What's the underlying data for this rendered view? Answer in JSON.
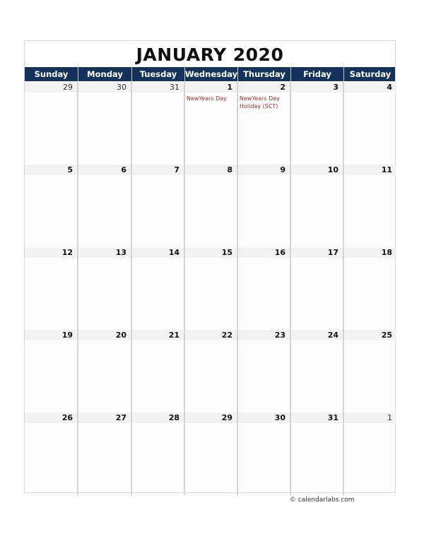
{
  "title": "JANUARY 2020",
  "weekdays": [
    "Sunday",
    "Monday",
    "Tuesday",
    "Wednesday",
    "Thursday",
    "Friday",
    "Saturday"
  ],
  "weeks": [
    [
      {
        "day": "29",
        "other": true
      },
      {
        "day": "30",
        "other": true
      },
      {
        "day": "31",
        "other": true
      },
      {
        "day": "1",
        "events": [
          "NewYears Day"
        ]
      },
      {
        "day": "2",
        "events": [
          "NewYears Day Holiday (SCT)"
        ]
      },
      {
        "day": "3"
      },
      {
        "day": "4"
      }
    ],
    [
      {
        "day": "5"
      },
      {
        "day": "6"
      },
      {
        "day": "7"
      },
      {
        "day": "8"
      },
      {
        "day": "9"
      },
      {
        "day": "10"
      },
      {
        "day": "11"
      }
    ],
    [
      {
        "day": "12"
      },
      {
        "day": "13"
      },
      {
        "day": "14"
      },
      {
        "day": "15"
      },
      {
        "day": "16"
      },
      {
        "day": "17"
      },
      {
        "day": "18"
      }
    ],
    [
      {
        "day": "19"
      },
      {
        "day": "20"
      },
      {
        "day": "21"
      },
      {
        "day": "22"
      },
      {
        "day": "23"
      },
      {
        "day": "24"
      },
      {
        "day": "25"
      }
    ],
    [
      {
        "day": "26"
      },
      {
        "day": "27"
      },
      {
        "day": "28"
      },
      {
        "day": "29"
      },
      {
        "day": "30"
      },
      {
        "day": "31"
      },
      {
        "day": "1",
        "other": true
      }
    ]
  ],
  "footer": "© calendarlabs.com",
  "colors": {
    "header_bg": "#15325b",
    "event_text": "#9b2c2c",
    "date_bar": "#f2f2f2"
  }
}
